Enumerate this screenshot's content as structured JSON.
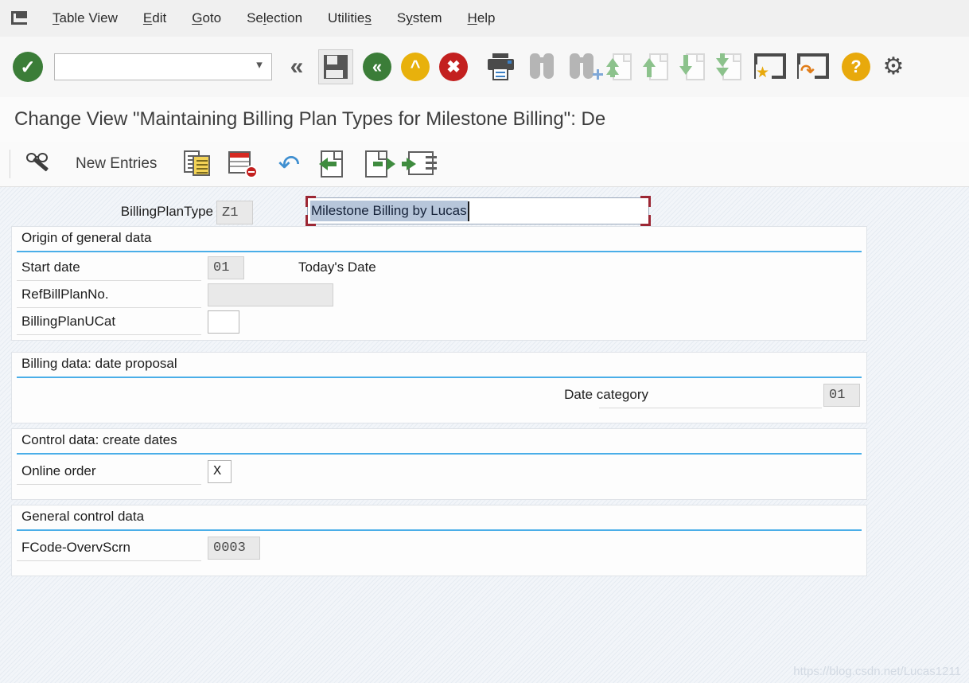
{
  "menu": {
    "system_icon": "window-menu-icon",
    "items": [
      {
        "label": "Table View",
        "accel": "T"
      },
      {
        "label": "Edit",
        "accel": "E"
      },
      {
        "label": "Goto",
        "accel": "G"
      },
      {
        "label": "Selection",
        "accel": "l"
      },
      {
        "label": "Utilities",
        "accel": "s"
      },
      {
        "label": "System",
        "accel": "y"
      },
      {
        "label": "Help",
        "accel": "H"
      }
    ]
  },
  "toolbar": {
    "enter_icon": "green-check-icon",
    "command_field_value": "",
    "command_field_placeholder": "",
    "command_dropdown_icon": "chevron-down-icon",
    "expand_icon": "double-chevron-left-icon",
    "save_icon": "floppy-disk-icon",
    "back_icon": "green-back-icon",
    "up_icon": "yellow-up-icon",
    "exit_icon": "red-cancel-icon",
    "print_icon": "printer-icon",
    "find_icon": "binoculars-icon",
    "find_next_icon": "binoculars-plus-icon",
    "first_page_icon": "first-page-icon",
    "prev_page_icon": "previous-page-icon",
    "next_page_icon": "next-page-icon",
    "last_page_icon": "last-page-icon",
    "favorite_icon": "create-favorite-icon",
    "new_window_icon": "new-window-icon",
    "help_icon": "help-question-icon",
    "customize_icon": "gear-icon"
  },
  "title": "Change View \"Maintaining Billing Plan Types for Milestone Billing\": De",
  "app_toolbar": {
    "display_change_icon": "glasses-pencil-icon",
    "new_entries_label": "New Entries",
    "copy_icon": "copy-as-icon",
    "delete_icon": "delete-entry-icon",
    "undo_icon": "undo-arrow-icon",
    "previous_entry_icon": "previous-entry-icon",
    "next_entry_icon": "next-entry-icon",
    "select_entries_icon": "select-entries-icon"
  },
  "header": {
    "label": "BillingPlanType",
    "key_value": "Z1",
    "description_value": "Milestone Billing by Lucas"
  },
  "groups": [
    {
      "title": "Origin of general data",
      "rows": [
        {
          "label": "Start date",
          "value": "01",
          "editable": false,
          "description": "Today's Date",
          "field_width": 46
        },
        {
          "label": "RefBillPlanNo.",
          "value": "",
          "editable": false,
          "description": "",
          "field_width": 158
        },
        {
          "label": "BillingPlanUCat",
          "value": "",
          "editable": true,
          "description": "",
          "field_width": 40
        }
      ]
    },
    {
      "title": "Billing data: date proposal",
      "rows": [
        {
          "label": "Date category",
          "value": "01",
          "editable": false,
          "description": "",
          "field_width": 46,
          "right_aligned": true
        }
      ]
    },
    {
      "title": "Control data: create dates",
      "rows": [
        {
          "label": "Online order",
          "value": "X",
          "editable": true,
          "description": "",
          "field_width": 30
        }
      ]
    },
    {
      "title": "General control data",
      "rows": [
        {
          "label": "FCode-OvervScrn",
          "value": "0003",
          "editable": false,
          "description": "",
          "field_width": 66
        }
      ]
    }
  ],
  "watermark": "https://blog.csdn.net/Lucas1211",
  "colors": {
    "accent_blue": "#4aaee8",
    "green": "#3b7d38",
    "yellow": "#e8a90c",
    "red": "#c3201f",
    "focus_bracket": "#9c2734",
    "selection": "#b7c6da"
  }
}
